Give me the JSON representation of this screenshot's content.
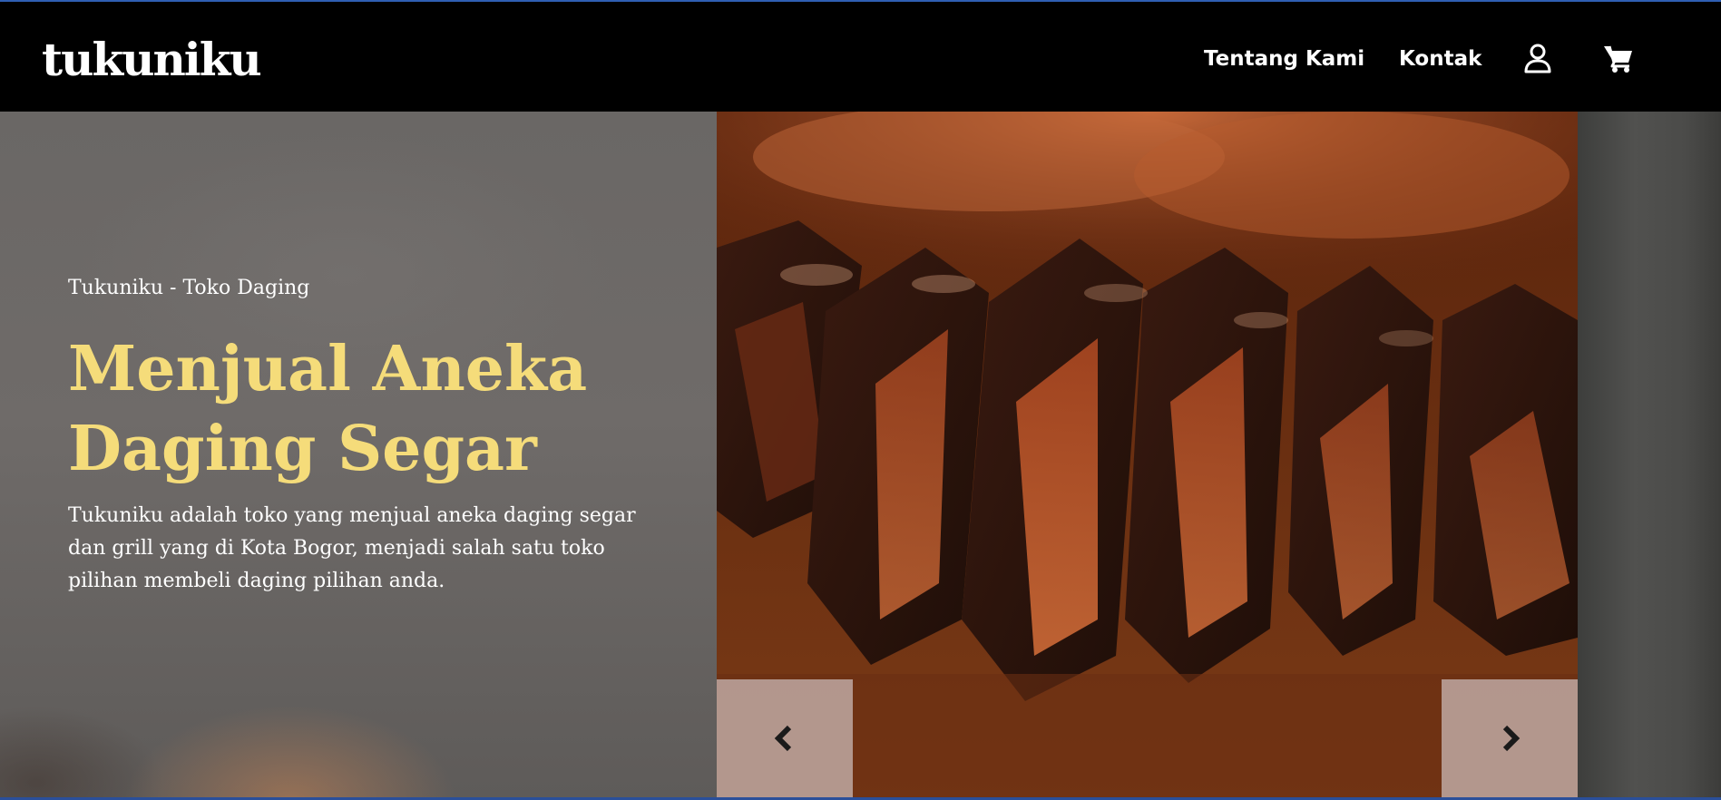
{
  "navbar": {
    "logo": "tukuniku",
    "links": [
      {
        "label": "Tentang Kami"
      },
      {
        "label": "Kontak"
      }
    ],
    "icons": [
      "user-icon",
      "cart-icon"
    ]
  },
  "hero": {
    "subtitle": "Tukuniku - Toko Daging",
    "title_line1": "Menjual Aneka",
    "title_line2": "Daging Segar",
    "description": "Tukuniku adalah toko yang menjual aneka daging segar dan grill yang di Kota Bogor, menjadi salah satu toko pilihan membeli daging pilihan anda.",
    "slider_controls": [
      "chevron-left-icon",
      "chevron-right-icon"
    ]
  },
  "colors": {
    "navbar_bg": "#000000",
    "title_accent": "#f5dc7a",
    "hero_overlay": "#6b6866"
  }
}
